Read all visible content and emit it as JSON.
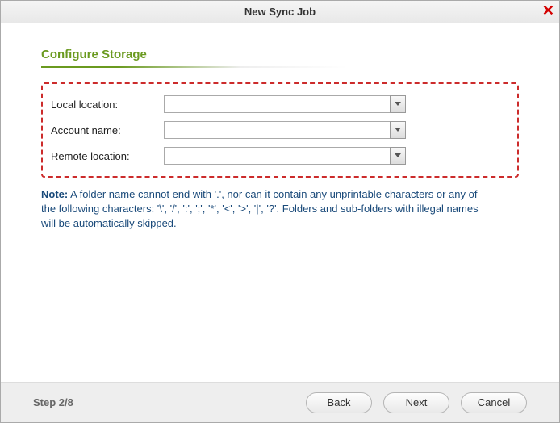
{
  "titlebar": {
    "title": "New Sync Job"
  },
  "section": {
    "heading": "Configure Storage"
  },
  "form": {
    "local_location": {
      "label": "Local location:",
      "value": ""
    },
    "account_name": {
      "label": "Account name:",
      "value": ""
    },
    "remote_location": {
      "label": "Remote location:",
      "value": ""
    }
  },
  "note": {
    "prefix": "Note:",
    "text": " A folder name cannot end with '.', nor can it contain any unprintable characters or any of the following characters: '\\', '/', ':', ';', '*', '<', '>', '|', '?'. Folders and sub-folders with illegal names will be automatically skipped."
  },
  "footer": {
    "step": "Step 2/8",
    "back": "Back",
    "next": "Next",
    "cancel": "Cancel"
  }
}
